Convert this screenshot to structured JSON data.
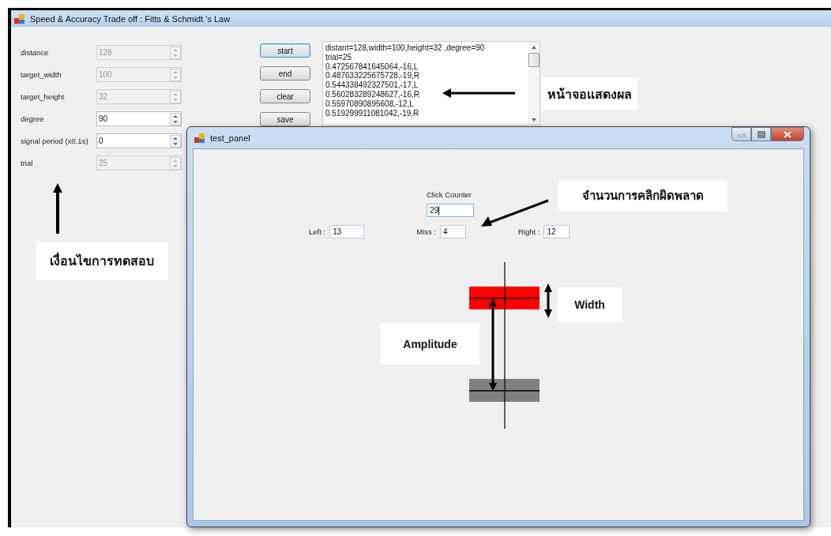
{
  "main_window": {
    "title": "Speed & Accuracy Trade off : Fitts & Schmidt 's Law"
  },
  "settings": [
    {
      "label": "distance",
      "value": "128",
      "disabled": true
    },
    {
      "label": "target_width",
      "value": "100",
      "disabled": true
    },
    {
      "label": "target_height",
      "value": "32",
      "disabled": true
    },
    {
      "label": "degree",
      "value": "90",
      "disabled": false
    },
    {
      "label": "signal period (x0.1s)",
      "value": "0",
      "disabled": false
    },
    {
      "label": "trial",
      "value": "25",
      "disabled": true
    }
  ],
  "buttons": [
    {
      "label": "start",
      "focused": true
    },
    {
      "label": "end",
      "focused": false
    },
    {
      "label": "clear",
      "focused": false
    },
    {
      "label": "save",
      "focused": false
    }
  ],
  "log": {
    "lines": [
      "distant=128,width=100,height=32 ,degree=90",
      "trial=25",
      "0.472567841645064,-16,L",
      "0.487633225675728,-19,R",
      "0.544338492327501,-17,L",
      "0.560283289248627,-16,R",
      "0.55970890895608,-12,L",
      "0.519299911081042,-19,R"
    ]
  },
  "test_panel": {
    "title": "test_panel",
    "click_counter": {
      "label": "Click Counter",
      "value": "29"
    },
    "counts": [
      {
        "label": "Left :",
        "value": "13"
      },
      {
        "label": "Miss :",
        "value": "4"
      },
      {
        "label": "Right :",
        "value": "12"
      }
    ]
  },
  "annotations": {
    "results_screen": "หน้าจอแสดงผล",
    "test_conditions": "เงื่อนไขการทดสอบ",
    "miss_clicks": "จำนวนการคลิกผิดพลาด",
    "width": "Width",
    "amplitude": "Amplitude"
  }
}
